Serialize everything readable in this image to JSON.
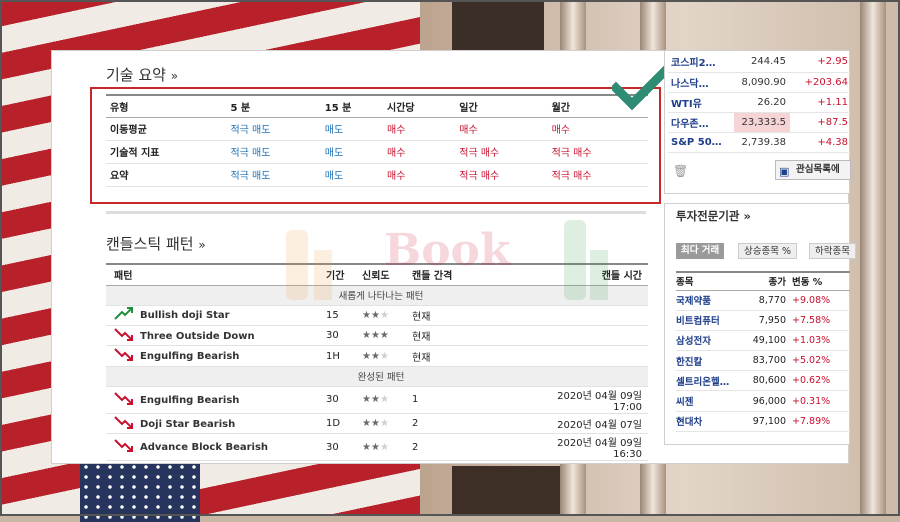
{
  "technical_summary": {
    "title": "기술 요약",
    "title_arrow": "»",
    "headers": [
      "유형",
      "5 분",
      "15 분",
      "시간당",
      "일간",
      "월간"
    ],
    "rows": [
      {
        "label": "이동평균",
        "cells": [
          {
            "text": "적극 매도",
            "tone": "sell"
          },
          {
            "text": "매도",
            "tone": "sell"
          },
          {
            "text": "매수",
            "tone": "buy"
          },
          {
            "text": "매수",
            "tone": "buy"
          },
          {
            "text": "매수",
            "tone": "buy"
          }
        ]
      },
      {
        "label": "기술적 지표",
        "cells": [
          {
            "text": "적극 매도",
            "tone": "sell"
          },
          {
            "text": "매도",
            "tone": "sell"
          },
          {
            "text": "매수",
            "tone": "buy"
          },
          {
            "text": "적극 매수",
            "tone": "buy"
          },
          {
            "text": "적극 매수",
            "tone": "buy"
          }
        ]
      },
      {
        "label": "요약",
        "cells": [
          {
            "text": "적극 매도",
            "tone": "sell"
          },
          {
            "text": "매도",
            "tone": "sell"
          },
          {
            "text": "매수",
            "tone": "buy"
          },
          {
            "text": "적극 매수",
            "tone": "buy"
          },
          {
            "text": "적극 매수",
            "tone": "buy"
          }
        ]
      }
    ]
  },
  "candlestick": {
    "title": "캔들스틱 패턴",
    "title_arrow": "»",
    "headers": [
      "패턴",
      "기간",
      "신뢰도",
      "캔들 간격",
      "캔들 시간"
    ],
    "group_new": "새롭게 나타나는 패턴",
    "group_done": "완성된 패턴",
    "emerging": [
      {
        "icon": "bullish-arrow-icon",
        "name": "Bullish doji Star",
        "period": "15",
        "stars": 2,
        "interval": "현재",
        "time": ""
      },
      {
        "icon": "bearish-arrow-icon",
        "name": "Three Outside Down",
        "period": "30",
        "stars": 3,
        "interval": "현재",
        "time": ""
      },
      {
        "icon": "bearish-arrow-icon",
        "name": "Engulfing Bearish",
        "period": "1H",
        "stars": 2,
        "interval": "현재",
        "time": ""
      }
    ],
    "completed": [
      {
        "icon": "bearish-arrow-icon",
        "name": "Engulfing Bearish",
        "period": "30",
        "stars": 2,
        "interval": "1",
        "time": "2020년 04월 09일 17:00"
      },
      {
        "icon": "bearish-arrow-icon",
        "name": "Doji Star Bearish",
        "period": "1D",
        "stars": 2,
        "interval": "2",
        "time": "2020년 04월 07일"
      },
      {
        "icon": "bearish-arrow-icon",
        "name": "Advance Block Bearish",
        "period": "30",
        "stars": 2,
        "interval": "2",
        "time": "2020년 04월 09일 16:30"
      }
    ]
  },
  "indices": [
    {
      "name": "코스피2…",
      "value": "244.45",
      "change": "+2.95",
      "highlight": false
    },
    {
      "name": "나스닥…",
      "value": "8,090.90",
      "change": "+203.64",
      "highlight": false
    },
    {
      "name": "WTI유",
      "value": "26.20",
      "change": "+1.11",
      "highlight": false
    },
    {
      "name": "다우존…",
      "value": "23,333.5",
      "change": "+87.5",
      "highlight": true
    },
    {
      "name": "S&P 50…",
      "value": "2,739.38",
      "change": "+4.38",
      "highlight": false
    }
  ],
  "watchlist_button": "관심목록에",
  "institutions": {
    "title": "투자전문기관",
    "title_arrow": "»",
    "tabs": [
      "최다 거래",
      "상승종목 %",
      "하락종목"
    ],
    "headers": [
      "종목",
      "종가",
      "변동 %"
    ],
    "rows": [
      {
        "name": "국제약품",
        "price": "8,770",
        "change": "+9.08%"
      },
      {
        "name": "비트컴퓨터",
        "price": "7,950",
        "change": "+7.58%"
      },
      {
        "name": "삼성전자",
        "price": "49,100",
        "change": "+1.03%"
      },
      {
        "name": "한진칼",
        "price": "83,700",
        "change": "+5.02%"
      },
      {
        "name": "셀트리온헬…",
        "price": "80,600",
        "change": "+0.62%"
      },
      {
        "name": "씨젠",
        "price": "96,000",
        "change": "+0.31%"
      },
      {
        "name": "현대차",
        "price": "97,100",
        "change": "+7.89%"
      }
    ]
  },
  "colors": {
    "sell": "#1e72b8",
    "buy": "#c8102e",
    "highlight": "#c62828",
    "check": "#2e8b74"
  }
}
